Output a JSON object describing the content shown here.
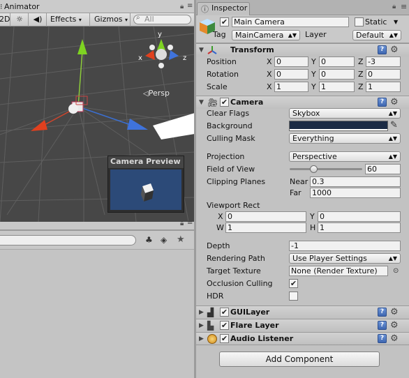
{
  "scene": {
    "tab_title": "Animator",
    "toolbar": {
      "mode_2d": "2D",
      "sun_icon": "sun-icon",
      "audio_icon": "speaker-icon",
      "effects_label": "Effects",
      "gizmos_label": "Gizmos",
      "search_placeholder": "All"
    },
    "gizmo": {
      "y": "y",
      "x": "x",
      "z": "z"
    },
    "persp_label": "Persp",
    "camera_preview_title": "Camera Preview",
    "colors": {
      "viewport_bg": "#474747",
      "preview_bg": "#2c4a78"
    }
  },
  "inspector": {
    "tab_title": "Inspector",
    "object": {
      "active": true,
      "name": "Main Camera",
      "static_label": "Static",
      "static_checked": false,
      "tag_label": "Tag",
      "tag_value": "MainCamera",
      "layer_label": "Layer",
      "layer_value": "Default"
    },
    "transform": {
      "title": "Transform",
      "position": {
        "label": "Position",
        "x": "0",
        "y": "0",
        "z": "-3"
      },
      "rotation": {
        "label": "Rotation",
        "x": "0",
        "y": "0",
        "z": "0"
      },
      "scale": {
        "label": "Scale",
        "x": "1",
        "y": "1",
        "z": "1"
      },
      "axis_x": "X",
      "axis_y": "Y",
      "axis_z": "Z"
    },
    "camera": {
      "title": "Camera",
      "enabled": true,
      "clear_flags_label": "Clear Flags",
      "clear_flags_value": "Skybox",
      "background_label": "Background",
      "background_color": "#1b2b45",
      "culling_mask_label": "Culling Mask",
      "culling_mask_value": "Everything",
      "projection_label": "Projection",
      "projection_value": "Perspective",
      "fov_label": "Field of View",
      "fov_value": "60",
      "fov_fraction": 0.33,
      "clipping_label": "Clipping Planes",
      "near_label": "Near",
      "near_value": "0.3",
      "far_label": "Far",
      "far_value": "1000",
      "viewport_label": "Viewport Rect",
      "vp_x_label": "X",
      "vp_x": "0",
      "vp_y_label": "Y",
      "vp_y": "0",
      "vp_w_label": "W",
      "vp_w": "1",
      "vp_h_label": "H",
      "vp_h": "1",
      "depth_label": "Depth",
      "depth_value": "-1",
      "rendering_path_label": "Rendering Path",
      "rendering_path_value": "Use Player Settings",
      "target_texture_label": "Target Texture",
      "target_texture_value": "None (Render Texture)",
      "occlusion_label": "Occlusion Culling",
      "occlusion_checked": true,
      "hdr_label": "HDR",
      "hdr_checked": false
    },
    "components": [
      {
        "title": "GUILayer",
        "enabled": true
      },
      {
        "title": "Flare Layer",
        "enabled": true
      },
      {
        "title": "Audio Listener",
        "enabled": true
      }
    ],
    "add_component_label": "Add Component"
  }
}
